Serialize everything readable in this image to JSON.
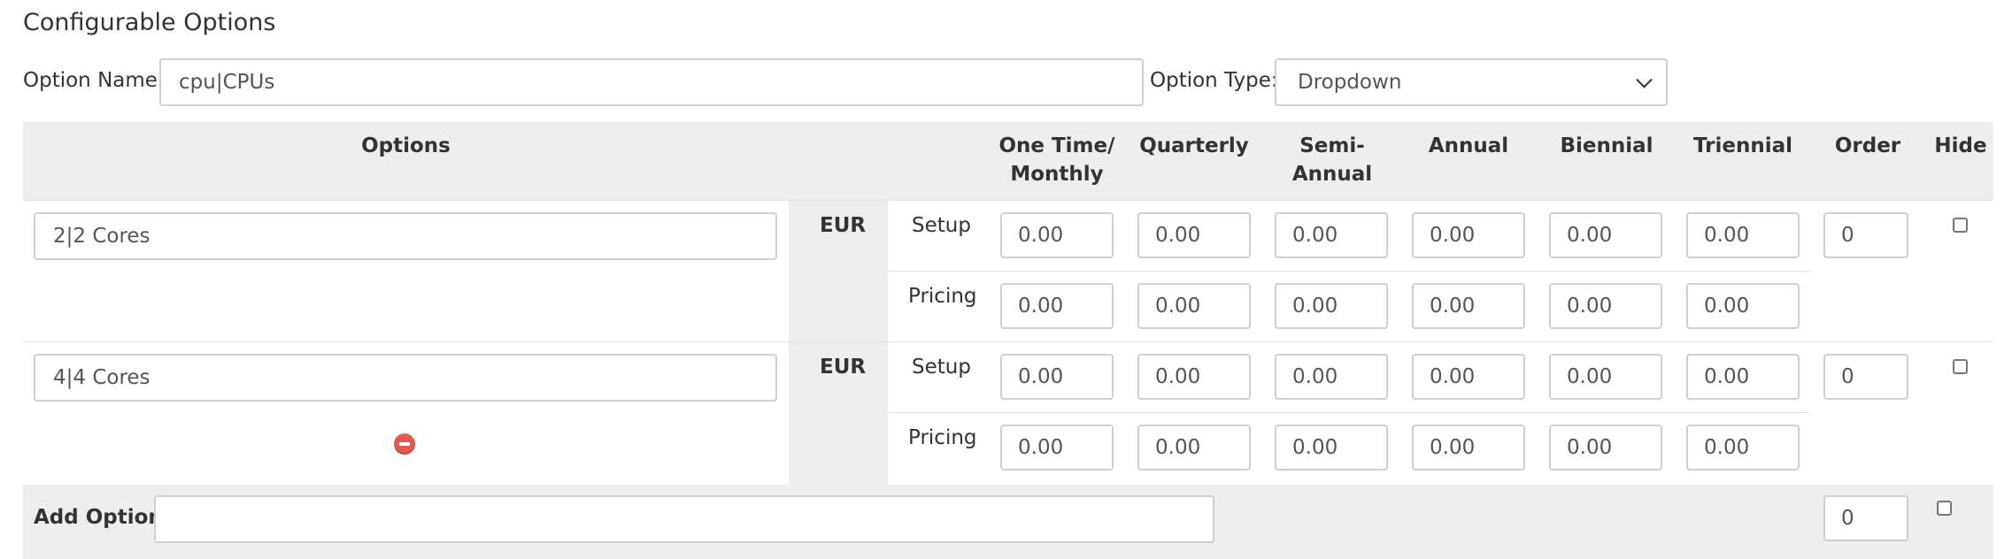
{
  "section_title": "Configurable Options",
  "option_name": {
    "label": "Option Name:",
    "value": "cpu|CPUs"
  },
  "option_type": {
    "label": "Option Type:",
    "value": "Dropdown"
  },
  "table": {
    "headers": {
      "options": "Options",
      "one_time_monthly": "One Time/ Monthly",
      "quarterly": "Quarterly",
      "semi_annual": "Semi- Annual",
      "annual": "Annual",
      "biennial": "Biennial",
      "triennial": "Triennial",
      "order": "Order",
      "hide": "Hide"
    },
    "rows": [
      {
        "name": "2|2 Cores",
        "currency": "EUR",
        "setup_label": "Setup",
        "pricing_label": "Pricing",
        "setup": [
          "0.00",
          "0.00",
          "0.00",
          "0.00",
          "0.00",
          "0.00"
        ],
        "pricing": [
          "0.00",
          "0.00",
          "0.00",
          "0.00",
          "0.00",
          "0.00"
        ],
        "order": "0",
        "hidden": false,
        "removable": false
      },
      {
        "name": "4|4 Cores",
        "currency": "EUR",
        "setup_label": "Setup",
        "pricing_label": "Pricing",
        "setup": [
          "0.00",
          "0.00",
          "0.00",
          "0.00",
          "0.00",
          "0.00"
        ],
        "pricing": [
          "0.00",
          "0.00",
          "0.00",
          "0.00",
          "0.00",
          "0.00"
        ],
        "order": "0",
        "hidden": false,
        "removable": true
      }
    ],
    "add_option": {
      "label": "Add Option:",
      "value": "",
      "order": "0",
      "hidden": false
    }
  },
  "colors": {
    "header_bg": "#eeeeee",
    "remove_icon": "#e35b4f"
  }
}
